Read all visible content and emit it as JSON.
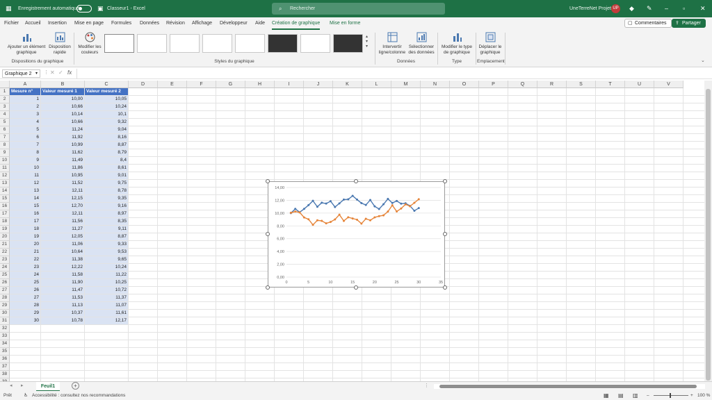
{
  "titlebar": {
    "autosave_label": "Enregistrement automatique",
    "doc_title": "Classeur1 - Excel",
    "search_placeholder": "Rechercher",
    "user_name": "UneTerreNet Projet",
    "user_initials": "UP"
  },
  "tabs": [
    "Fichier",
    "Accueil",
    "Insertion",
    "Mise en page",
    "Formules",
    "Données",
    "Révision",
    "Affichage",
    "Développeur",
    "Aide",
    "Création de graphique",
    "Mise en forme"
  ],
  "active_tab": "Création de graphique",
  "buttons": {
    "comments": "Commentaires",
    "share": "Partager"
  },
  "ribbon": {
    "add_element": "Ajouter un élément graphique",
    "quick_layout": "Disposition rapide",
    "change_colors": "Modifier les couleurs",
    "group_layouts": "Dispositions du graphique",
    "group_styles": "Styles du graphique",
    "switch_rowcol": "Intervertir ligne/colonne",
    "select_data": "Sélectionner des données",
    "group_data": "Données",
    "change_type": "Modifier le type de graphique",
    "group_type": "Type",
    "move_chart": "Déplacer le graphique",
    "group_location": "Emplacement"
  },
  "formula_bar": {
    "name_box": "Graphique 2",
    "fx": "fx"
  },
  "columns": [
    "A",
    "B",
    "C",
    "D",
    "E",
    "F",
    "G",
    "H",
    "I",
    "J",
    "K",
    "L",
    "M",
    "N",
    "O",
    "P",
    "Q",
    "R",
    "S",
    "T",
    "U",
    "V"
  ],
  "headers": [
    "Mesure n°",
    "Valeur mesuré 1",
    "Valeur mesuré 2"
  ],
  "rows": [
    [
      "1",
      "10,00",
      "10,05"
    ],
    [
      "2",
      "10,66",
      "10,24"
    ],
    [
      "3",
      "10,14",
      "10,1"
    ],
    [
      "4",
      "10,66",
      "9,32"
    ],
    [
      "5",
      "11,24",
      "9,04"
    ],
    [
      "6",
      "11,92",
      "8,16"
    ],
    [
      "7",
      "10,99",
      "8,87"
    ],
    [
      "8",
      "11,62",
      "8,79"
    ],
    [
      "9",
      "11,49",
      "8,4"
    ],
    [
      "10",
      "11,86",
      "8,61"
    ],
    [
      "11",
      "10,95",
      "9,01"
    ],
    [
      "12",
      "11,52",
      "9,75"
    ],
    [
      "13",
      "12,11",
      "8,78"
    ],
    [
      "14",
      "12,15",
      "9,35"
    ],
    [
      "15",
      "12,70",
      "9,16"
    ],
    [
      "16",
      "12,11",
      "8,97"
    ],
    [
      "17",
      "11,56",
      "8,35"
    ],
    [
      "18",
      "11,27",
      "9,11"
    ],
    [
      "19",
      "12,05",
      "8,87"
    ],
    [
      "20",
      "11,06",
      "9,33"
    ],
    [
      "21",
      "10,64",
      "9,53"
    ],
    [
      "22",
      "11,38",
      "9,65"
    ],
    [
      "23",
      "12,22",
      "10,24"
    ],
    [
      "24",
      "11,58",
      "11,22"
    ],
    [
      "25",
      "11,90",
      "10,25"
    ],
    [
      "26",
      "11,47",
      "10,72"
    ],
    [
      "27",
      "11,53",
      "11,37"
    ],
    [
      "28",
      "11,13",
      "11,07"
    ],
    [
      "29",
      "10,37",
      "11,61"
    ],
    [
      "30",
      "10,78",
      "12,17"
    ]
  ],
  "row_numbers_total": 39,
  "chart_data": {
    "type": "scatter",
    "title": "",
    "xlabel": "",
    "ylabel": "",
    "xlim": [
      0,
      35
    ],
    "ylim": [
      0,
      14
    ],
    "x_ticks": [
      "0",
      "5",
      "10",
      "15",
      "20",
      "25",
      "30",
      "35"
    ],
    "y_ticks": [
      "0,00",
      "2,00",
      "4,00",
      "6,00",
      "8,00",
      "10,00",
      "12,00",
      "14,00"
    ],
    "grid": true,
    "x": [
      1,
      2,
      3,
      4,
      5,
      6,
      7,
      8,
      9,
      10,
      11,
      12,
      13,
      14,
      15,
      16,
      17,
      18,
      19,
      20,
      21,
      22,
      23,
      24,
      25,
      26,
      27,
      28,
      29,
      30
    ],
    "series": [
      {
        "color": "#4a78b0",
        "values": [
          10.0,
          10.66,
          10.14,
          10.66,
          11.24,
          11.92,
          10.99,
          11.62,
          11.49,
          11.86,
          10.95,
          11.52,
          12.11,
          12.15,
          12.7,
          12.11,
          11.56,
          11.27,
          12.05,
          11.06,
          10.64,
          11.38,
          12.22,
          11.58,
          11.9,
          11.47,
          11.53,
          11.13,
          10.37,
          10.78
        ]
      },
      {
        "color": "#e6853a",
        "values": [
          10.05,
          10.24,
          10.1,
          9.32,
          9.04,
          8.16,
          8.87,
          8.79,
          8.4,
          8.61,
          9.01,
          9.75,
          8.78,
          9.35,
          9.16,
          8.97,
          8.35,
          9.11,
          8.87,
          9.33,
          9.53,
          9.65,
          10.24,
          11.22,
          10.25,
          10.72,
          11.37,
          11.07,
          11.61,
          12.17
        ]
      }
    ]
  },
  "sheet_tab": "Feuil1",
  "status": {
    "ready": "Prêt",
    "accessibility": "Accessibilité : consultez nos recommandations",
    "zoom": "100 %"
  },
  "colors": {
    "brand": "#1e7145",
    "table_header": "#4472c4",
    "table_band": "#dae3f3"
  }
}
